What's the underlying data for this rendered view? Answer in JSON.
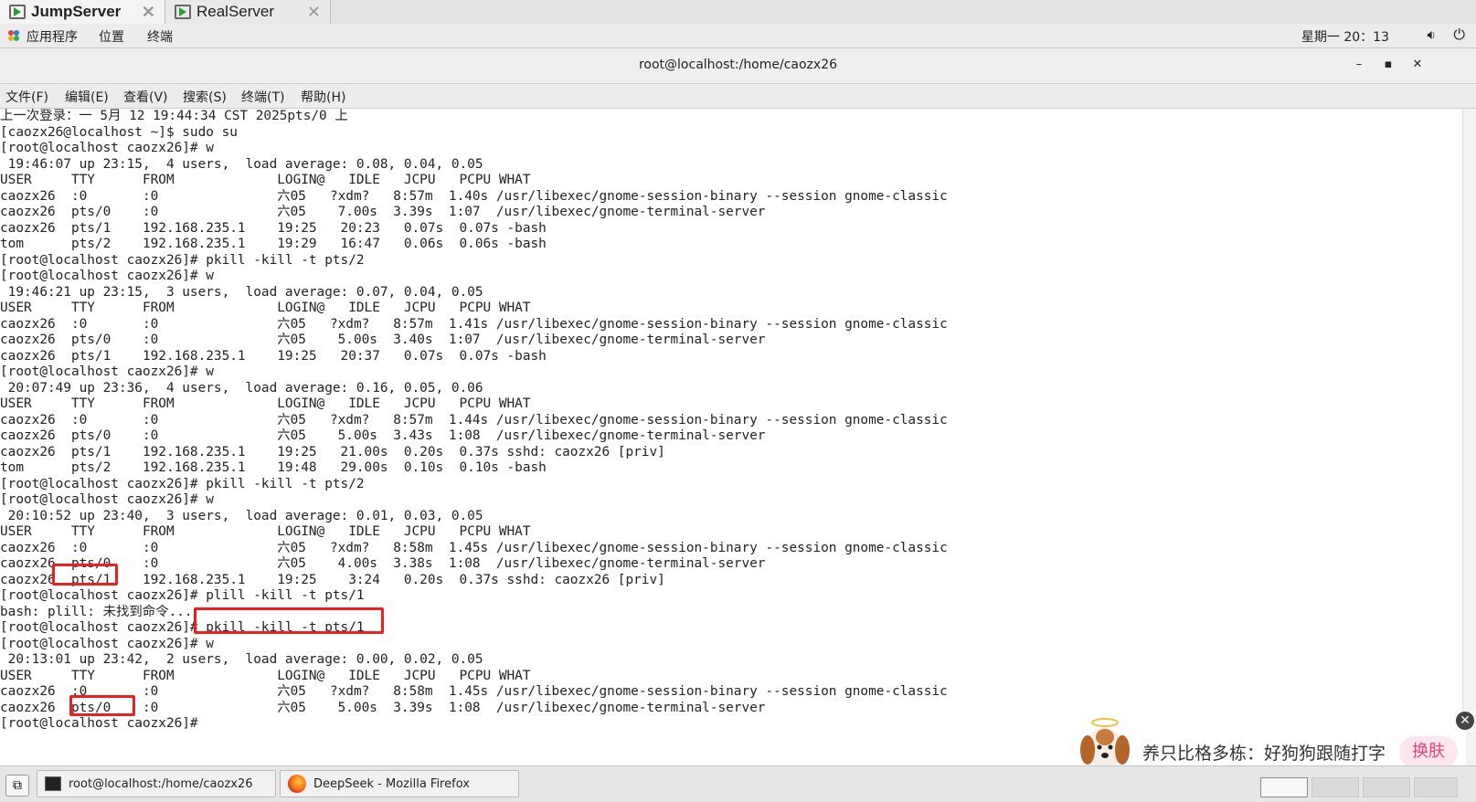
{
  "vm_tabs": [
    {
      "label": "JumpServer",
      "close": "✕"
    },
    {
      "label": "RealServer",
      "close": "✕"
    }
  ],
  "top_panel": {
    "applications": "应用程序",
    "places": "位置",
    "terminal": "终端",
    "clock": "星期一 20：13"
  },
  "window": {
    "title": "root@localhost:/home/caozx26",
    "minimize": "–",
    "maximize": "▪",
    "close": "✕"
  },
  "menubar": [
    "文件(F)",
    "编辑(E)",
    "查看(V)",
    "搜索(S)",
    "终端(T)",
    "帮助(H)"
  ],
  "terminal_lines": [
    "上一次登录：一 5月 12 19:44:34 CST 2025pts/0 上",
    "[caozx26@localhost ~]$ sudo su",
    "[root@localhost caozx26]# w",
    " 19:46:07 up 23:15,  4 users,  load average: 0.08, 0.04, 0.05",
    "USER     TTY      FROM             LOGIN@   IDLE   JCPU   PCPU WHAT",
    "caozx26  :0       :0               六05   ?xdm?   8:57m  1.40s /usr/libexec/gnome-session-binary --session gnome-classic",
    "caozx26  pts/0    :0               六05    7.00s  3.39s  1:07  /usr/libexec/gnome-terminal-server",
    "caozx26  pts/1    192.168.235.1    19:25   20:23   0.07s  0.07s -bash",
    "tom      pts/2    192.168.235.1    19:29   16:47   0.06s  0.06s -bash",
    "[root@localhost caozx26]# pkill -kill -t pts/2",
    "[root@localhost caozx26]# w",
    " 19:46:21 up 23:15,  3 users,  load average: 0.07, 0.04, 0.05",
    "USER     TTY      FROM             LOGIN@   IDLE   JCPU   PCPU WHAT",
    "caozx26  :0       :0               六05   ?xdm?   8:57m  1.41s /usr/libexec/gnome-session-binary --session gnome-classic",
    "caozx26  pts/0    :0               六05    5.00s  3.40s  1:07  /usr/libexec/gnome-terminal-server",
    "caozx26  pts/1    192.168.235.1    19:25   20:37   0.07s  0.07s -bash",
    "[root@localhost caozx26]# w",
    " 20:07:49 up 23:36,  4 users,  load average: 0.16, 0.05, 0.06",
    "USER     TTY      FROM             LOGIN@   IDLE   JCPU   PCPU WHAT",
    "caozx26  :0       :0               六05   ?xdm?   8:57m  1.44s /usr/libexec/gnome-session-binary --session gnome-classic",
    "caozx26  pts/0    :0               六05    5.00s  3.43s  1:08  /usr/libexec/gnome-terminal-server",
    "caozx26  pts/1    192.168.235.1    19:25   21.00s  0.20s  0.37s sshd: caozx26 [priv]",
    "tom      pts/2    192.168.235.1    19:48   29.00s  0.10s  0.10s -bash",
    "[root@localhost caozx26]# pkill -kill -t pts/2",
    "[root@localhost caozx26]# w",
    " 20:10:52 up 23:40,  3 users,  load average: 0.01, 0.03, 0.05",
    "USER     TTY      FROM             LOGIN@   IDLE   JCPU   PCPU WHAT",
    "caozx26  :0       :0               六05   ?xdm?   8:58m  1.45s /usr/libexec/gnome-session-binary --session gnome-classic",
    "caozx26  pts/0    :0               六05    4.00s  3.38s  1:08  /usr/libexec/gnome-terminal-server",
    "caozx26  pts/1    192.168.235.1    19:25    3:24   0.20s  0.37s sshd: caozx26 [priv]",
    "[root@localhost caozx26]# plill -kill -t pts/1",
    "bash: plill: 未找到命令...",
    "[root@localhost caozx26]# pkill -kill -t pts/1",
    "[root@localhost caozx26]# w",
    " 20:13:01 up 23:42,  2 users,  load average: 0.00, 0.02, 0.05",
    "USER     TTY      FROM             LOGIN@   IDLE   JCPU   PCPU WHAT",
    "caozx26  :0       :0               六05   ?xdm?   8:58m  1.45s /usr/libexec/gnome-session-binary --session gnome-classic",
    "caozx26  pts/0    :0               六05    5.00s  3.39s  1:08  /usr/libexec/gnome-terminal-server",
    "[root@localhost caozx26]# "
  ],
  "taskbar": {
    "terminal_task": "root@localhost:/home/caozx26",
    "firefox_task": "DeepSeek - Mozilla Firefox"
  },
  "ad": {
    "text": "养只比格多栋：好狗狗跟随打字",
    "button": "换肤",
    "close": "✕"
  },
  "colors": {
    "annotation_red": "#ee1f1f",
    "ad_button": "#e8427a",
    "terminal_bg": "#ffffff"
  }
}
